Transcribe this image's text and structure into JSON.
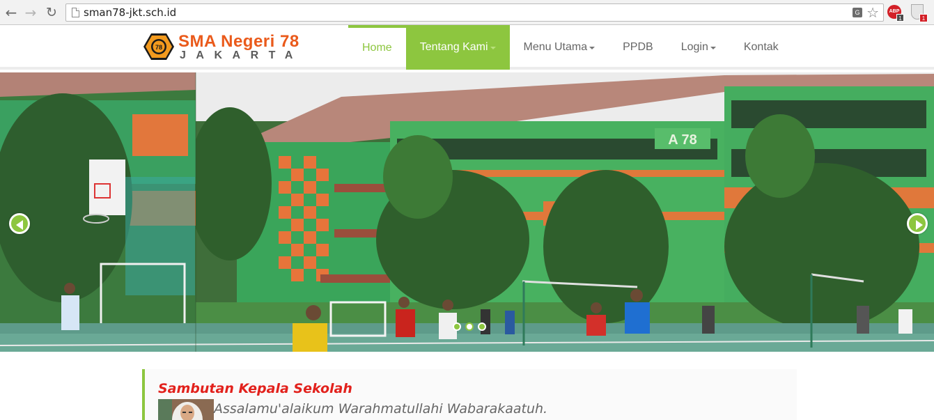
{
  "browser": {
    "url": "sman78-jkt.sch.id",
    "back_icon": "←",
    "forward_icon": "→",
    "reload_icon": "↻",
    "translate_icon_label": "G",
    "star_icon": "☆",
    "adblock_label": "ABP",
    "adblock_badge": "1",
    "extension_badge": "1"
  },
  "site": {
    "logo_title": "SMA Negeri 78",
    "logo_subtitle": "JAKARTA",
    "logo_emblem_text": "78"
  },
  "menu": {
    "items": [
      {
        "label": "Home",
        "state": "current"
      },
      {
        "label": "Tentang Kami",
        "state": "active",
        "dropdown": true
      },
      {
        "label": "Menu Utama",
        "dropdown": true
      },
      {
        "label": "PPDB"
      },
      {
        "label": "Login",
        "dropdown": true
      },
      {
        "label": "Kontak"
      }
    ]
  },
  "slider": {
    "building_sign": "A 78",
    "slide_count": 3,
    "active_slide": 2
  },
  "welcome": {
    "title": "Sambutan Kepala Sekolah",
    "text": "Assalamu'alaikum Warahmatullahi Wabarakaatuh."
  },
  "colors": {
    "accent": "#8dc63f",
    "logo_orange": "#ea5a1b",
    "title_red": "#e2211c"
  }
}
